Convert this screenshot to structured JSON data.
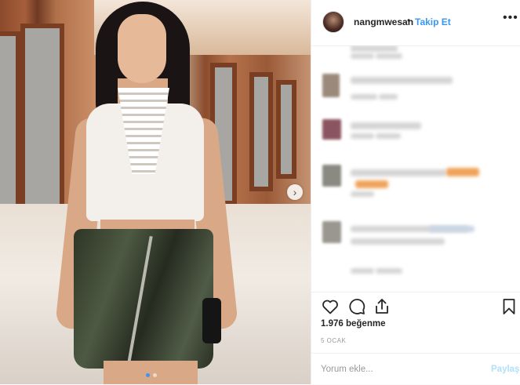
{
  "post": {
    "username": "nangmwesan",
    "separator": "•",
    "follow_label": "Takip Et",
    "more_icon_text": "•••",
    "likes_text": "1.976 beğenme",
    "date_text": "5 OCAK",
    "comment_placeholder": "Yorum ekle...",
    "post_label": "Paylaş",
    "next_icon": "›"
  },
  "icons": [
    "heart-icon",
    "comment-icon",
    "share-icon",
    "bookmark-icon"
  ],
  "colors": {
    "link_blue": "#3897f0",
    "post_disabled": "#b2dffc",
    "text_primary": "#262626",
    "text_secondary": "#999999"
  }
}
